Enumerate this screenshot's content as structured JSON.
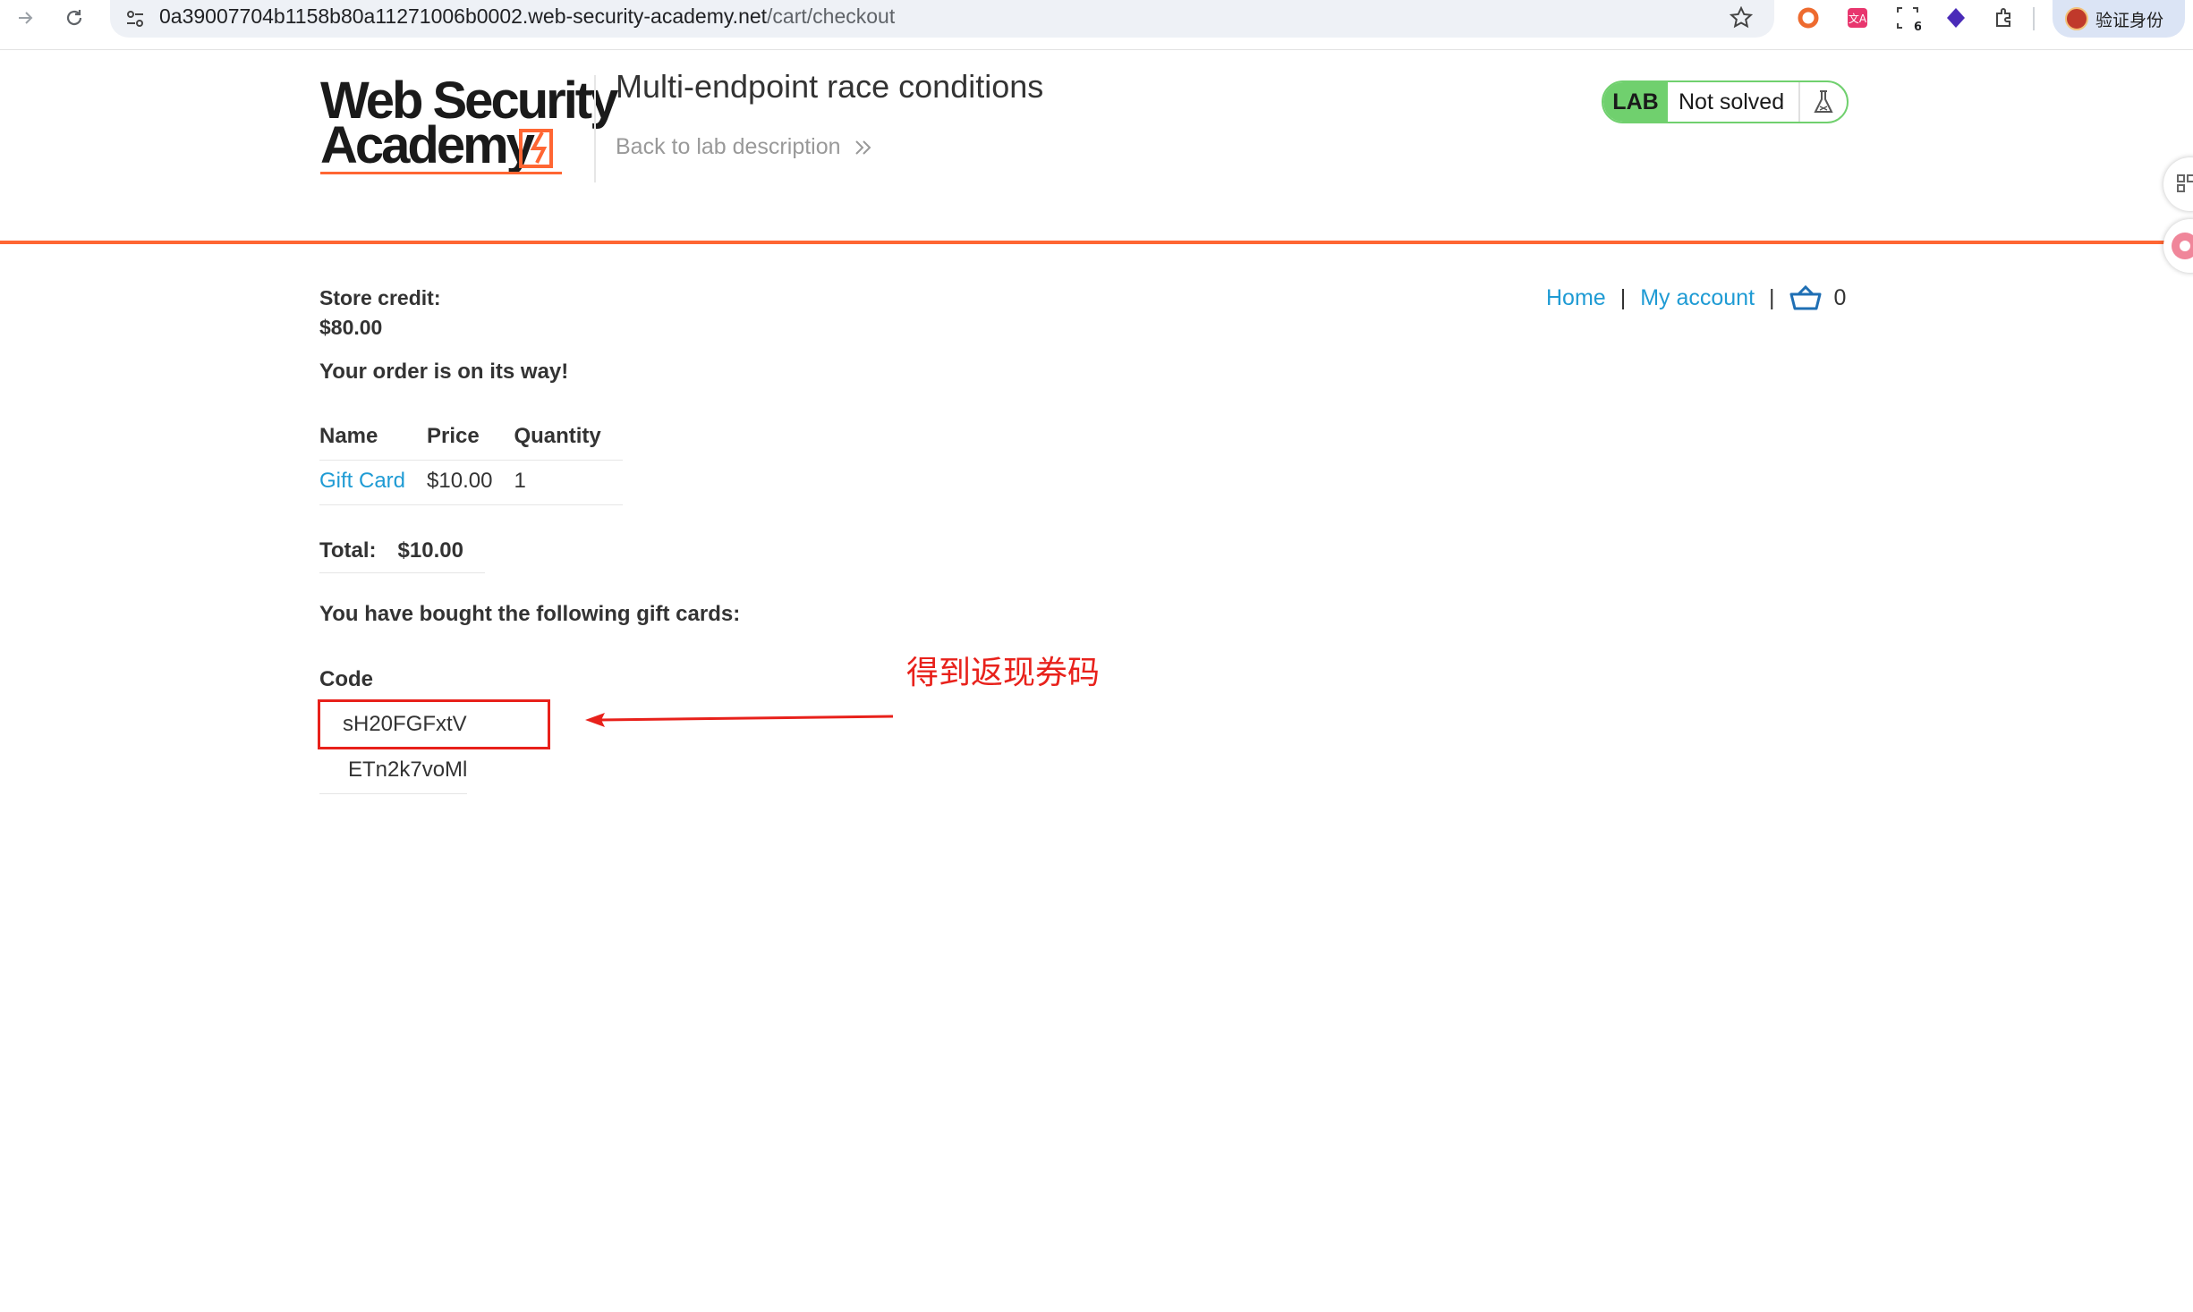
{
  "browser": {
    "url_host": "0a39007704b1158b80a11271006b0002.web-security-academy.net",
    "url_path": "/cart/checkout",
    "profile_label": "验证身份",
    "extension_badge": "6"
  },
  "header": {
    "logo_line1": "Web Security",
    "logo_line2": "Academy",
    "lab_title": "Multi-endpoint race conditions",
    "back_link": "Back to lab description",
    "status_tag": "LAB",
    "status_text": "Not solved"
  },
  "nav": {
    "home": "Home",
    "separator": "|",
    "my_account": "My account",
    "cart_count": "0"
  },
  "store": {
    "credit_label": "Store credit:",
    "credit_value": "$80.00",
    "order_message": "Your order is on its way!"
  },
  "cart_table": {
    "headers": [
      "Name",
      "Price",
      "Quantity"
    ],
    "rows": [
      {
        "name": "Gift Card",
        "price": "$10.00",
        "quantity": "1"
      }
    ]
  },
  "total": {
    "label": "Total:",
    "value": "$10.00"
  },
  "gift_cards": {
    "message": "You have bought the following gift cards:",
    "header": "Code",
    "codes": [
      "sH20FGFxtV",
      "ETn2k7voMl"
    ]
  },
  "annotation": {
    "label": "得到返现券码",
    "color": "#e8211b"
  },
  "colors": {
    "accent_orange": "#ff6633",
    "link_blue": "#1f9bd4",
    "status_green": "#70d06e"
  }
}
